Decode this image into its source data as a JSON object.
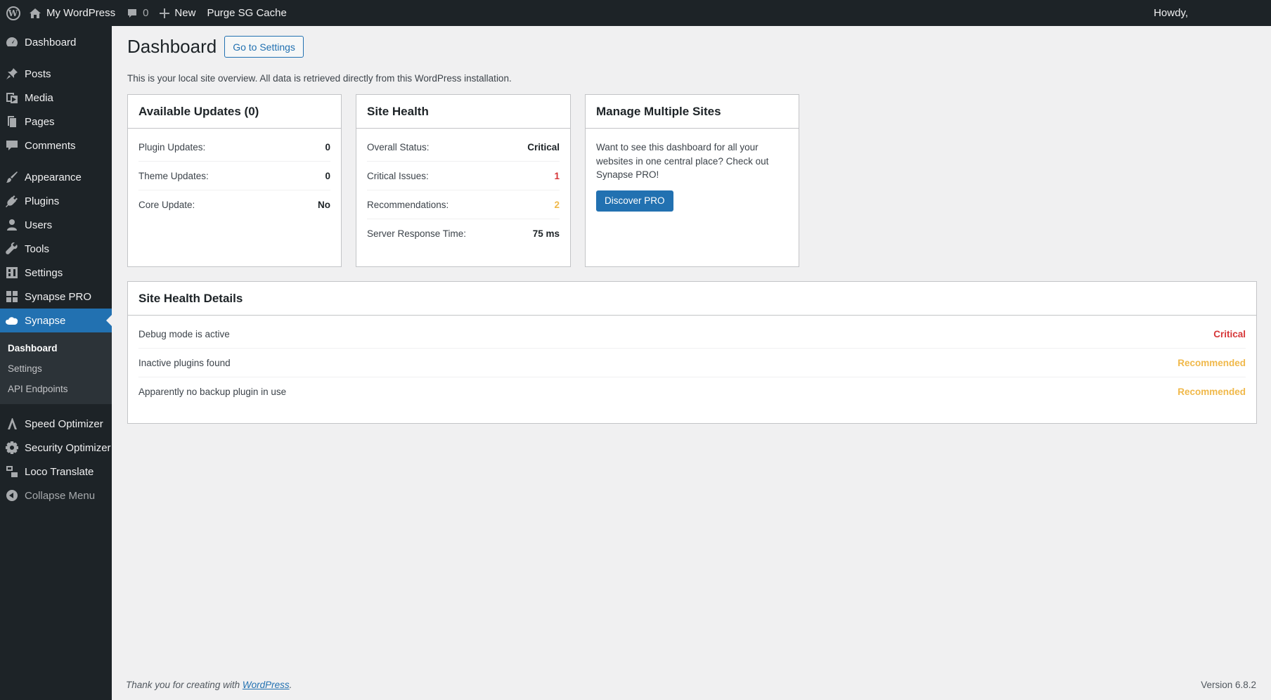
{
  "adminbar": {
    "site_name": "My WordPress",
    "comments_count": "0",
    "new_label": "New",
    "purge_label": "Purge SG Cache",
    "howdy": "Howdy,"
  },
  "sidebar": {
    "items": [
      {
        "label": "Dashboard",
        "icon": "dashboard-icon"
      },
      {
        "label": "Posts",
        "icon": "pin-icon"
      },
      {
        "label": "Media",
        "icon": "media-icon"
      },
      {
        "label": "Pages",
        "icon": "pages-icon"
      },
      {
        "label": "Comments",
        "icon": "comment-icon"
      },
      {
        "label": "Appearance",
        "icon": "brush-icon"
      },
      {
        "label": "Plugins",
        "icon": "plug-icon"
      },
      {
        "label": "Users",
        "icon": "user-icon"
      },
      {
        "label": "Tools",
        "icon": "wrench-icon"
      },
      {
        "label": "Settings",
        "icon": "settings-icon"
      },
      {
        "label": "Synapse PRO",
        "icon": "grid-icon"
      },
      {
        "label": "Synapse",
        "icon": "cloud-icon"
      },
      {
        "label": "Speed Optimizer",
        "icon": "speed-icon"
      },
      {
        "label": "Security Optimizer",
        "icon": "shield-gear-icon"
      },
      {
        "label": "Loco Translate",
        "icon": "translate-icon"
      },
      {
        "label": "Collapse Menu",
        "icon": "collapse-icon"
      }
    ],
    "submenu": [
      "Dashboard",
      "Settings",
      "API Endpoints"
    ]
  },
  "main": {
    "title": "Dashboard",
    "settings_button": "Go to Settings",
    "intro": "This is your local site overview. All data is retrieved directly from this WordPress installation."
  },
  "updates_card": {
    "title": "Available Updates (0)",
    "rows": [
      {
        "label": "Plugin Updates:",
        "value": "0"
      },
      {
        "label": "Theme Updates:",
        "value": "0"
      },
      {
        "label": "Core Update:",
        "value": "No"
      }
    ]
  },
  "health_card": {
    "title": "Site Health",
    "rows": [
      {
        "label": "Overall Status:",
        "value": "Critical"
      },
      {
        "label": "Critical Issues:",
        "value": "1"
      },
      {
        "label": "Recommendations:",
        "value": "2"
      },
      {
        "label": "Server Response Time:",
        "value": "75 ms"
      }
    ]
  },
  "sites_card": {
    "title": "Manage Multiple Sites",
    "text": "Want to see this dashboard for all your websites in one central place? Check out Synapse PRO!",
    "button": "Discover PRO"
  },
  "details_card": {
    "title": "Site Health Details",
    "rows": [
      {
        "label": "Debug mode is active",
        "status": "Critical"
      },
      {
        "label": "Inactive plugins found",
        "status": "Recommended"
      },
      {
        "label": "Apparently no backup plugin in use",
        "status": "Recommended"
      }
    ]
  },
  "footer": {
    "thanks": "Thank you for creating with",
    "link": "WordPress",
    "period": ".",
    "version": "Version 6.8.2"
  },
  "colors": {
    "admin_dark": "#1d2327",
    "accent": "#2271b1",
    "critical": "#d63638",
    "recommended": "#f0b849"
  }
}
